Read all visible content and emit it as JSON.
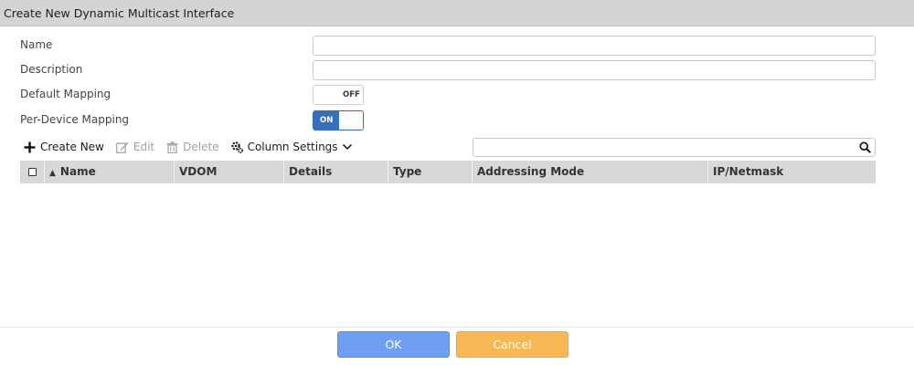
{
  "dialog": {
    "title": "Create New Dynamic Multicast Interface"
  },
  "form": {
    "name_label": "Name",
    "name_value": "",
    "description_label": "Description",
    "description_value": "",
    "default_mapping_label": "Default Mapping",
    "default_mapping_state": "OFF",
    "per_device_mapping_label": "Per-Device Mapping",
    "per_device_mapping_state": "ON"
  },
  "toolbar": {
    "create_new": "Create New",
    "edit": "Edit",
    "delete": "Delete",
    "column_settings": "Column Settings",
    "search_value": ""
  },
  "table": {
    "sort_indicator": "▲",
    "columns": [
      "Name",
      "VDOM",
      "Details",
      "Type",
      "Addressing Mode",
      "IP/Netmask"
    ],
    "rows": []
  },
  "footer": {
    "ok": "OK",
    "cancel": "Cancel"
  },
  "colors": {
    "primary": "#6f9ff2",
    "warning": "#f5b855",
    "toggle_on": "#3670ba",
    "header_bg": "#d4d4d4"
  }
}
